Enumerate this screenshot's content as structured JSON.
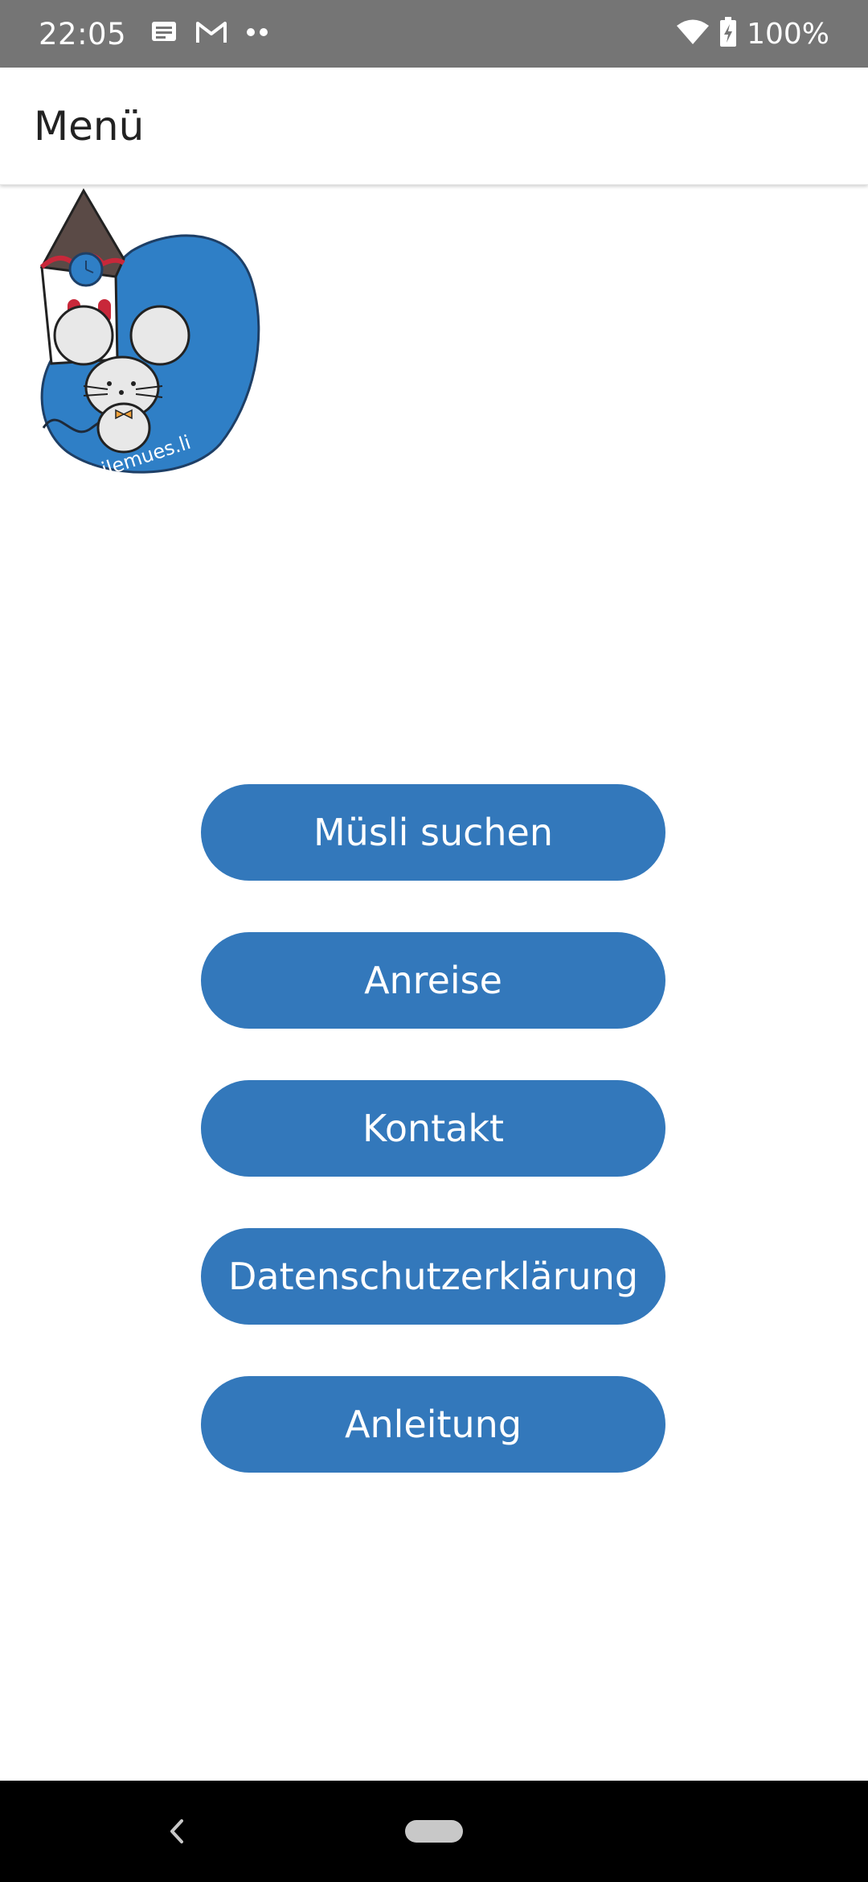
{
  "status_bar": {
    "time": "22:05",
    "battery": "100%",
    "left_icons": [
      "message-icon",
      "gmail-icon",
      "more-dots-icon"
    ],
    "right_icons": [
      "wifi-icon",
      "battery-charging-icon"
    ]
  },
  "app_bar": {
    "title": "Menü"
  },
  "logo": {
    "text": "chilemues.li",
    "colors": {
      "blue": "#2f7fc6",
      "roof": "#5a4a46",
      "trim": "#c8283a",
      "mouse": "#e8e8e8",
      "bowtie": "#f2a23a"
    }
  },
  "menu": {
    "buttons": [
      {
        "label": "Müsli suchen"
      },
      {
        "label": "Anreise"
      },
      {
        "label": "Kontakt"
      },
      {
        "label": "Datenschutzerklärung"
      },
      {
        "label": "Anleitung"
      }
    ]
  },
  "nav_bar": {
    "icons": [
      "back-icon",
      "home-pill-icon"
    ]
  },
  "colors": {
    "status_bar_bg": "#757575",
    "button_bg": "#3378bb",
    "button_text": "#ffffff",
    "nav_bar_bg": "#000000"
  }
}
